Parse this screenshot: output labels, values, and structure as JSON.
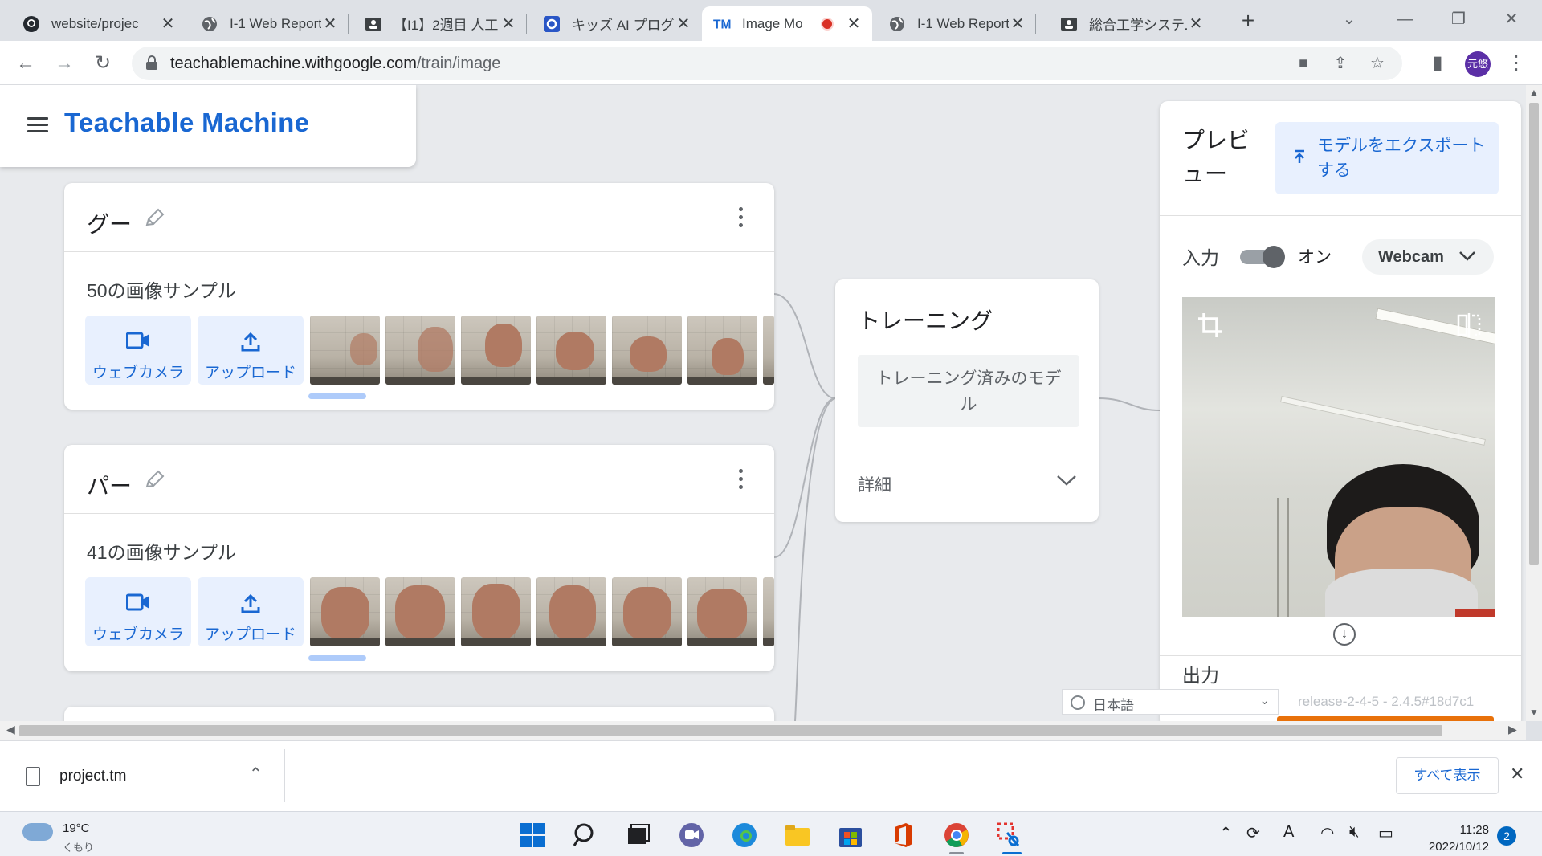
{
  "browser": {
    "tabs": [
      {
        "title": "website/projec",
        "favicon": "github-icon",
        "active": false
      },
      {
        "title": "I-1 Web Report",
        "favicon": "globe-icon",
        "active": false
      },
      {
        "title": "【I1】2週目 人工",
        "favicon": "classroom-icon",
        "active": false
      },
      {
        "title": "キッズ AI プログラ",
        "favicon": "square-logo-icon",
        "active": false
      },
      {
        "title": "Image Mo",
        "favicon": "tm-logo-icon",
        "active": true,
        "recording": true
      },
      {
        "title": "I-1 Web Report",
        "favicon": "globe-icon",
        "active": false
      },
      {
        "title": "総合工学システム",
        "favicon": "classroom-icon",
        "active": false
      }
    ],
    "url_host": "teachablemachine.withgoogle.com",
    "url_path": "/train/image",
    "profile_initials": "元悠"
  },
  "app": {
    "brand": "Teachable Machine",
    "classes": [
      {
        "name": "グー",
        "samples_label": "50の画像サンプル",
        "webcam_label": "ウェブカメラ",
        "upload_label": "アップロード",
        "pose": "fist"
      },
      {
        "name": "パー",
        "samples_label": "41の画像サンプル",
        "webcam_label": "ウェブカメラ",
        "upload_label": "アップロード",
        "pose": "open"
      }
    ],
    "training": {
      "title": "トレーニング",
      "button": "トレーニング済みのモデル",
      "advanced": "詳細"
    },
    "preview": {
      "title": "プレビュー",
      "export_button": "モデルをエクスポートする",
      "input_label": "入力",
      "toggle_state": "オン",
      "source": "Webcam",
      "output_label": "出力"
    },
    "language": "日本語",
    "release": "release-2-4-5 - 2.4.5#18d7c1"
  },
  "downloads": {
    "file": "project.tm",
    "show_all": "すべて表示"
  },
  "taskbar": {
    "temperature": "19°C",
    "condition": "くもり",
    "time": "11:28",
    "date": "2022/10/12",
    "notifications": "2"
  },
  "colors": {
    "accent": "#1967d2",
    "accent_bg": "#e8f0fe",
    "recording": "#d93025"
  }
}
